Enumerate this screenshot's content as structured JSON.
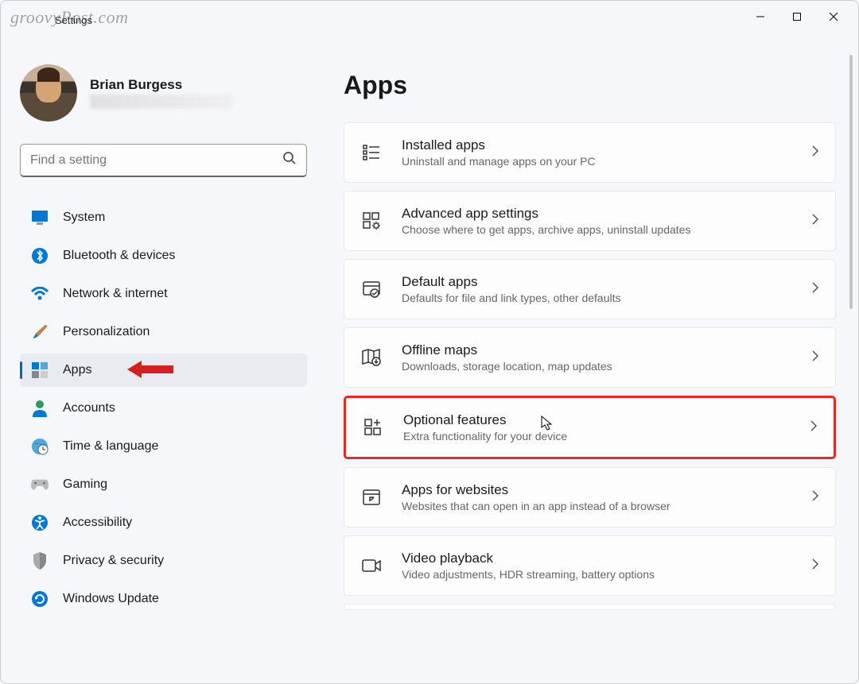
{
  "watermark": "groovyPost.com",
  "window": {
    "title": "Settings"
  },
  "profile": {
    "name": "Brian Burgess"
  },
  "search": {
    "placeholder": "Find a setting"
  },
  "sidebar": {
    "items": [
      {
        "label": "System"
      },
      {
        "label": "Bluetooth & devices"
      },
      {
        "label": "Network & internet"
      },
      {
        "label": "Personalization"
      },
      {
        "label": "Apps"
      },
      {
        "label": "Accounts"
      },
      {
        "label": "Time & language"
      },
      {
        "label": "Gaming"
      },
      {
        "label": "Accessibility"
      },
      {
        "label": "Privacy & security"
      },
      {
        "label": "Windows Update"
      }
    ]
  },
  "page": {
    "title": "Apps"
  },
  "cards": [
    {
      "title": "Installed apps",
      "desc": "Uninstall and manage apps on your PC"
    },
    {
      "title": "Advanced app settings",
      "desc": "Choose where to get apps, archive apps, uninstall updates"
    },
    {
      "title": "Default apps",
      "desc": "Defaults for file and link types, other defaults"
    },
    {
      "title": "Offline maps",
      "desc": "Downloads, storage location, map updates"
    },
    {
      "title": "Optional features",
      "desc": "Extra functionality for your device"
    },
    {
      "title": "Apps for websites",
      "desc": "Websites that can open in an app instead of a browser"
    },
    {
      "title": "Video playback",
      "desc": "Video adjustments, HDR streaming, battery options"
    }
  ]
}
